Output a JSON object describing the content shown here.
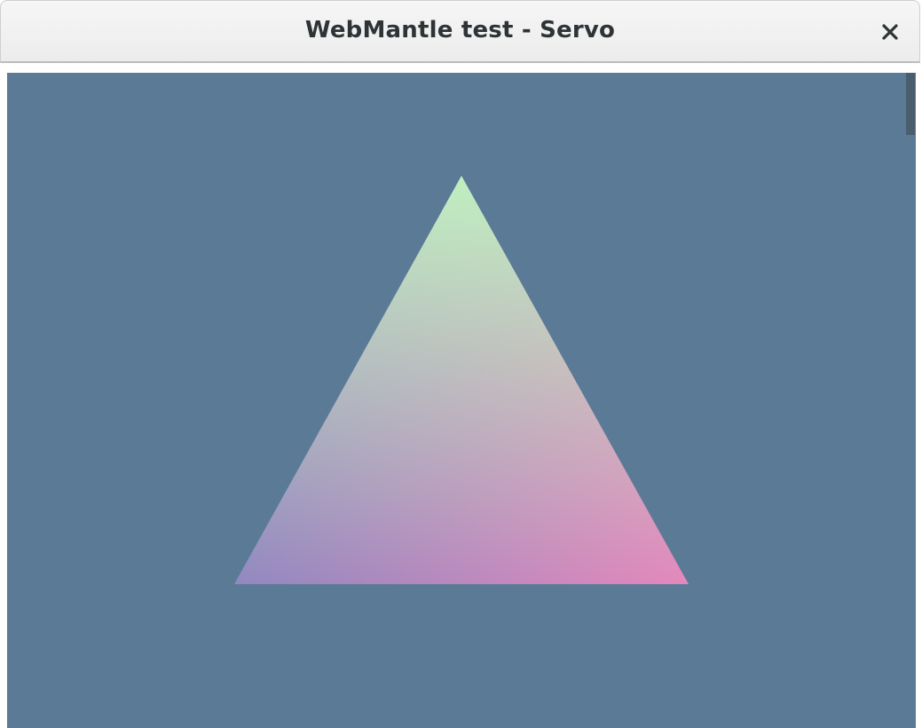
{
  "window": {
    "title": "WebMantle test - Servo",
    "close_icon": "close-icon"
  },
  "canvas": {
    "background_color": "#5a7a96",
    "triangle": {
      "vertex_colors": {
        "top": "#c0efc0",
        "bottom_left": "#9188c0",
        "bottom_right": "#e488bc"
      }
    }
  },
  "scrollbar": {
    "thumb_color": "#4a5e6e"
  }
}
